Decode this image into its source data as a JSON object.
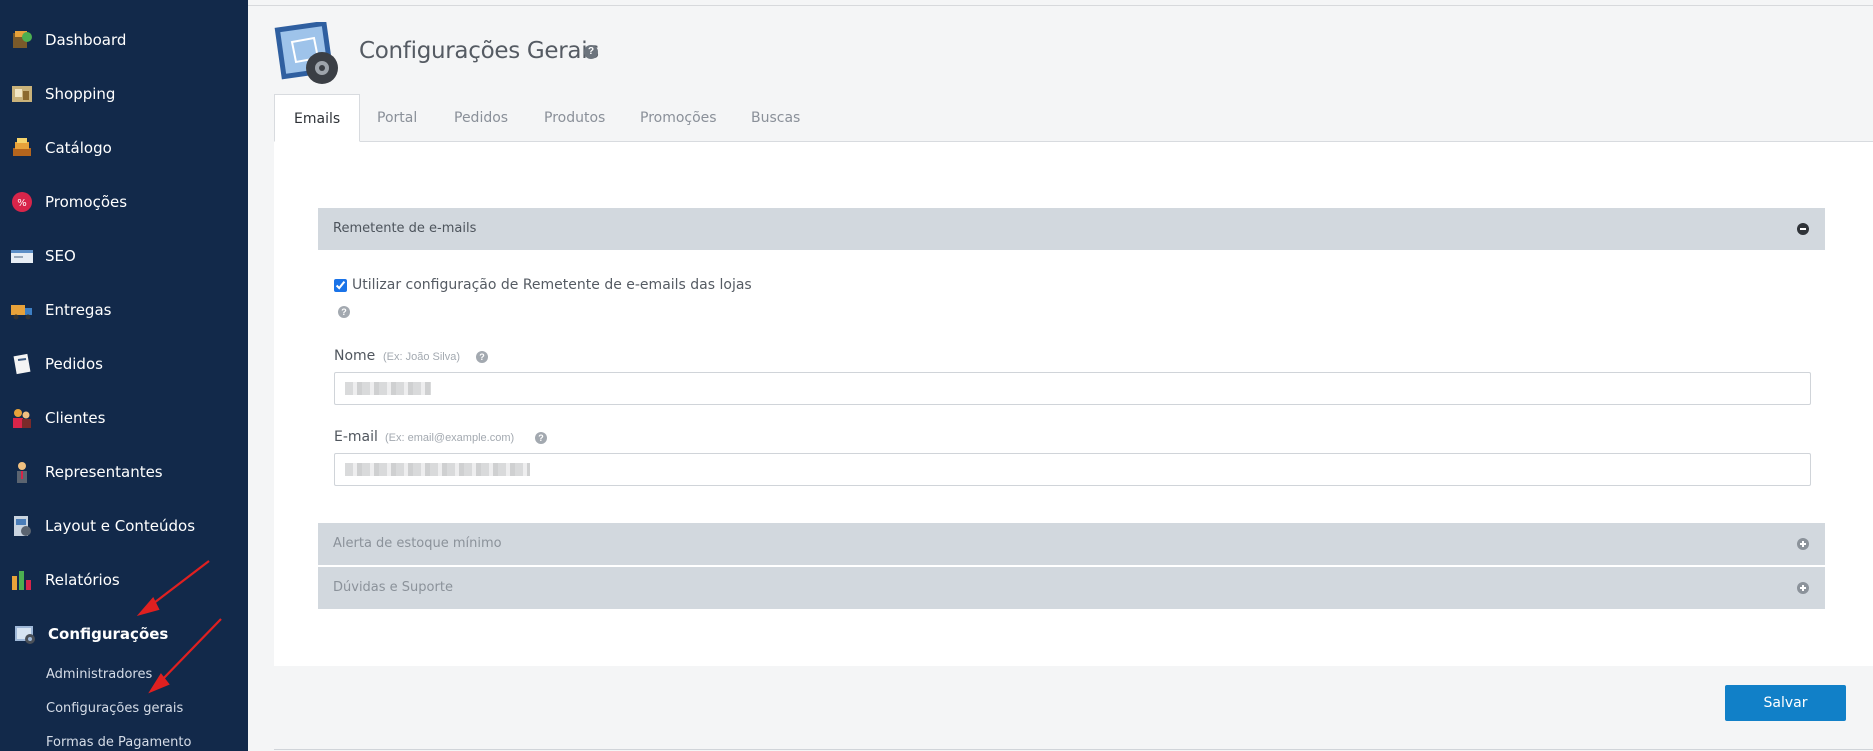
{
  "sidebar": {
    "items": [
      {
        "label": "Dashboard",
        "icon": "dashboard-icon"
      },
      {
        "label": "Shopping",
        "icon": "shopping-icon"
      },
      {
        "label": "Catálogo",
        "icon": "catalog-icon"
      },
      {
        "label": "Promoções",
        "icon": "promotions-icon"
      },
      {
        "label": "SEO",
        "icon": "seo-icon"
      },
      {
        "label": "Entregas",
        "icon": "delivery-truck-icon"
      },
      {
        "label": "Pedidos",
        "icon": "orders-icon"
      },
      {
        "label": "Clientes",
        "icon": "customers-icon"
      },
      {
        "label": "Representantes",
        "icon": "representative-icon"
      },
      {
        "label": "Layout e Conteúdos",
        "icon": "layout-icon"
      },
      {
        "label": "Relatórios",
        "icon": "reports-chart-icon"
      },
      {
        "label": "Configurações",
        "icon": "settings-icon"
      }
    ],
    "sub_items": [
      {
        "label": "Administradores"
      },
      {
        "label": "Configurações gerais"
      },
      {
        "label": "Formas de Pagamento"
      }
    ]
  },
  "page": {
    "title": "Configurações Gerais",
    "help_glyph": "?"
  },
  "tabs": [
    {
      "label": "Emails"
    },
    {
      "label": "Portal"
    },
    {
      "label": "Pedidos"
    },
    {
      "label": "Produtos"
    },
    {
      "label": "Promoções"
    },
    {
      "label": "Buscas"
    }
  ],
  "sections": {
    "sender": {
      "label": "Remetente de e-mails"
    },
    "stock_alert": {
      "label": "Alerta de estoque mínimo"
    },
    "support": {
      "label": "Dúvidas e Suporte"
    }
  },
  "form": {
    "use_store_sender_label": "Utilizar configuração de Remetente de e-emails das lojas",
    "use_store_sender_checked": true,
    "name_label": "Nome",
    "name_hint": "(Ex: João Silva)",
    "email_label": "E-mail",
    "email_hint": "(Ex: email@example.com)"
  },
  "actions": {
    "save_label": "Salvar"
  },
  "colors": {
    "sidebar_bg": "#12294a",
    "accent_button": "#1180c8",
    "section_header_bg": "#d2d8de",
    "annotation_arrow": "#e02020"
  }
}
